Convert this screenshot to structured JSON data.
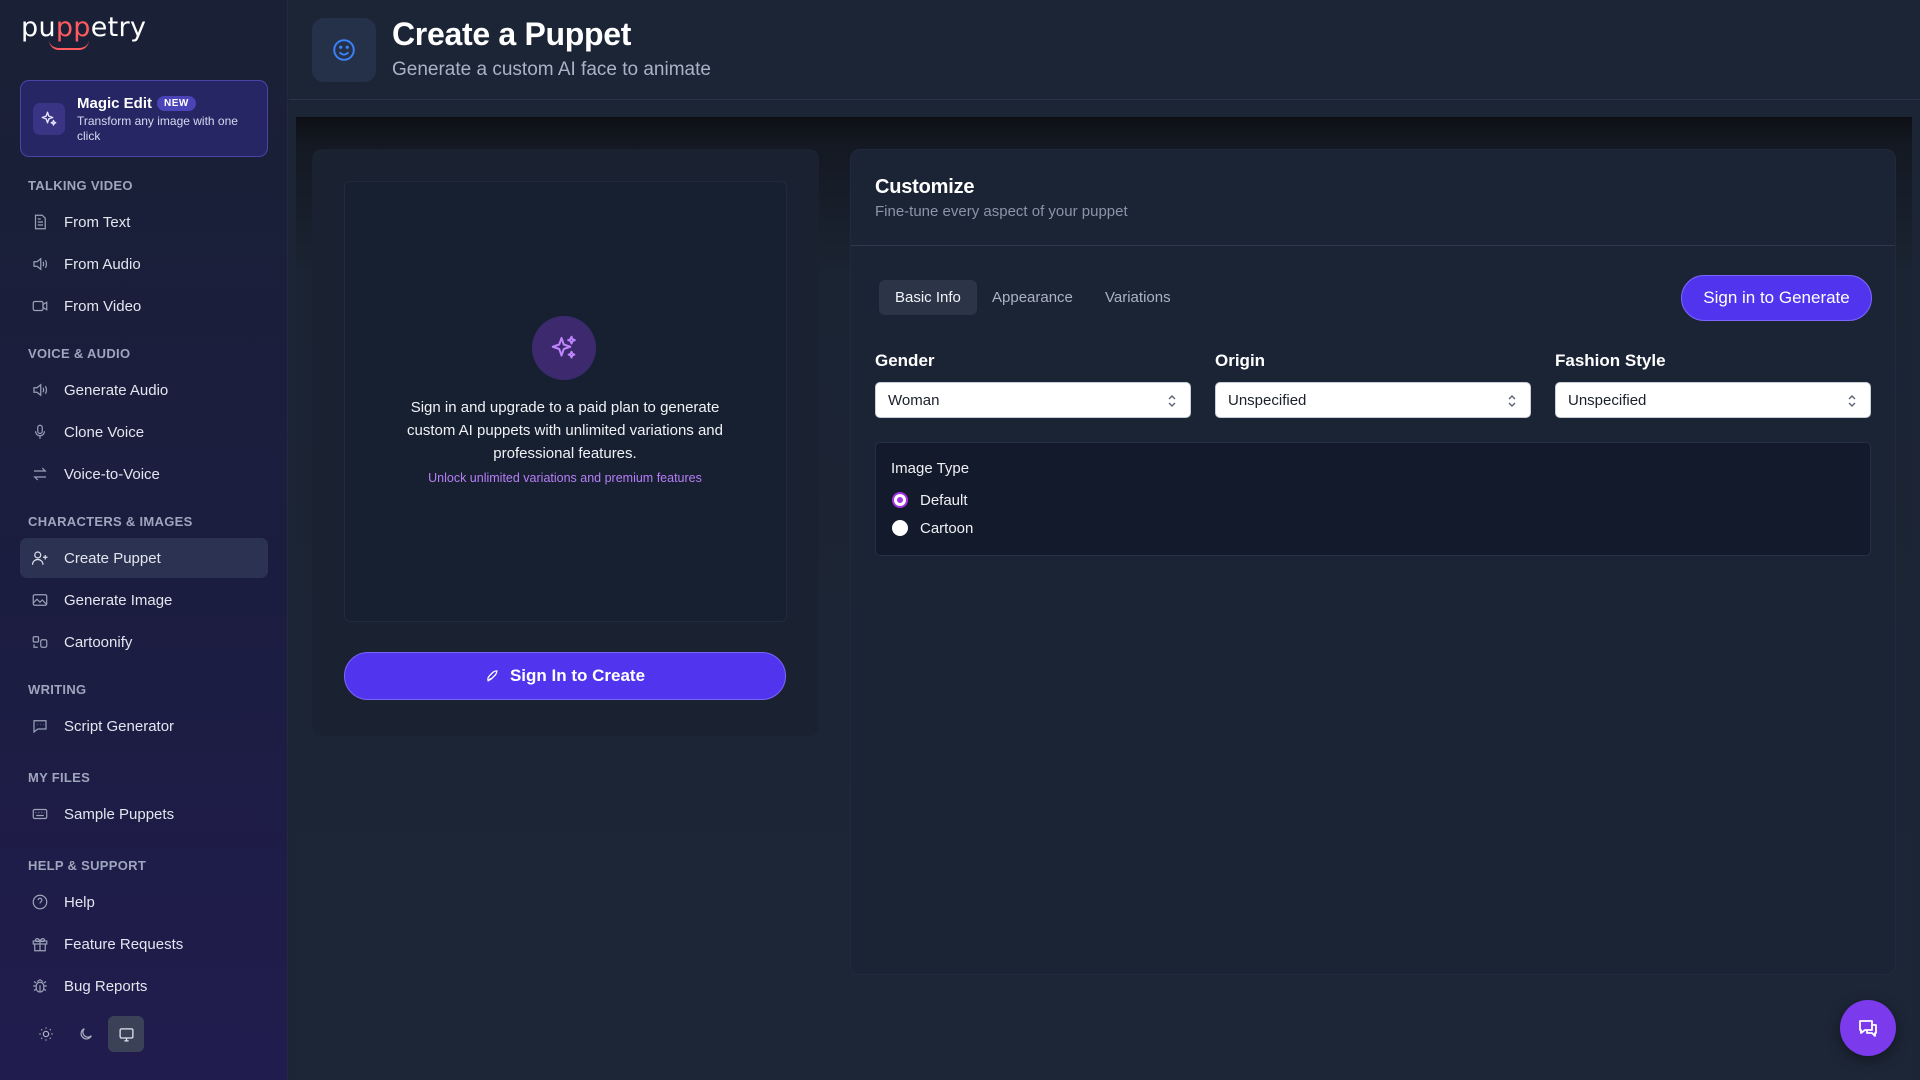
{
  "app": {
    "logo_pre": "pu",
    "logo_accent": "pp",
    "logo_post": "etry"
  },
  "magic_edit": {
    "title": "Magic Edit",
    "badge": "NEW",
    "description": "Transform any image with one click"
  },
  "sidebar": {
    "sections": [
      {
        "label": "TALKING VIDEO",
        "items": [
          {
            "label": "From Text",
            "icon": "file-text-icon"
          },
          {
            "label": "From Audio",
            "icon": "speaker-icon"
          },
          {
            "label": "From Video",
            "icon": "video-camera-icon"
          }
        ]
      },
      {
        "label": "VOICE & AUDIO",
        "items": [
          {
            "label": "Generate Audio",
            "icon": "speaker-icon"
          },
          {
            "label": "Clone Voice",
            "icon": "microphone-icon"
          },
          {
            "label": "Voice-to-Voice",
            "icon": "swap-arrows-icon"
          }
        ]
      },
      {
        "label": "CHARACTERS & IMAGES",
        "items": [
          {
            "label": "Create Puppet",
            "icon": "user-plus-icon",
            "active": true
          },
          {
            "label": "Generate Image",
            "icon": "image-icon"
          },
          {
            "label": "Cartoonify",
            "icon": "cartoonify-icon"
          }
        ]
      },
      {
        "label": "WRITING",
        "items": [
          {
            "label": "Script Generator",
            "icon": "chat-bubble-icon"
          }
        ]
      },
      {
        "label": "MY FILES",
        "items": [
          {
            "label": "Sample Puppets",
            "icon": "keyboard-icon"
          }
        ]
      },
      {
        "label": "HELP & SUPPORT",
        "items": [
          {
            "label": "Help",
            "icon": "help-circle-icon"
          },
          {
            "label": "Feature Requests",
            "icon": "gift-icon"
          },
          {
            "label": "Bug Reports",
            "icon": "bug-icon"
          }
        ]
      }
    ],
    "theme_modes": [
      "light",
      "dark",
      "system"
    ],
    "theme_selected": "system"
  },
  "header": {
    "title": "Create a Puppet",
    "subtitle": "Generate a custom AI face to animate",
    "icon": "smiley-icon"
  },
  "preview": {
    "message": "Sign in and upgrade to a paid plan to generate custom AI puppets with unlimited variations and professional features.",
    "unlock": "Unlock unlimited variations and premium features",
    "button": "Sign In to Create"
  },
  "customize": {
    "title": "Customize",
    "subtitle": "Fine-tune every aspect of your puppet",
    "tabs": [
      {
        "label": "Basic Info",
        "active": true
      },
      {
        "label": "Appearance",
        "active": false
      },
      {
        "label": "Variations",
        "active": false
      }
    ],
    "generate_button": "Sign in to Generate",
    "fields": [
      {
        "label": "Gender",
        "value": "Woman"
      },
      {
        "label": "Origin",
        "value": "Unspecified"
      },
      {
        "label": "Fashion Style",
        "value": "Unspecified"
      }
    ],
    "image_type": {
      "label": "Image Type",
      "options": [
        {
          "label": "Default",
          "checked": true
        },
        {
          "label": "Cartoon",
          "checked": false
        }
      ]
    }
  },
  "colors": {
    "primary": "#5034ee",
    "accent_purple": "#7c3aed",
    "radio_accent": "#a335e5",
    "logo_accent": "#ff5a5f"
  }
}
